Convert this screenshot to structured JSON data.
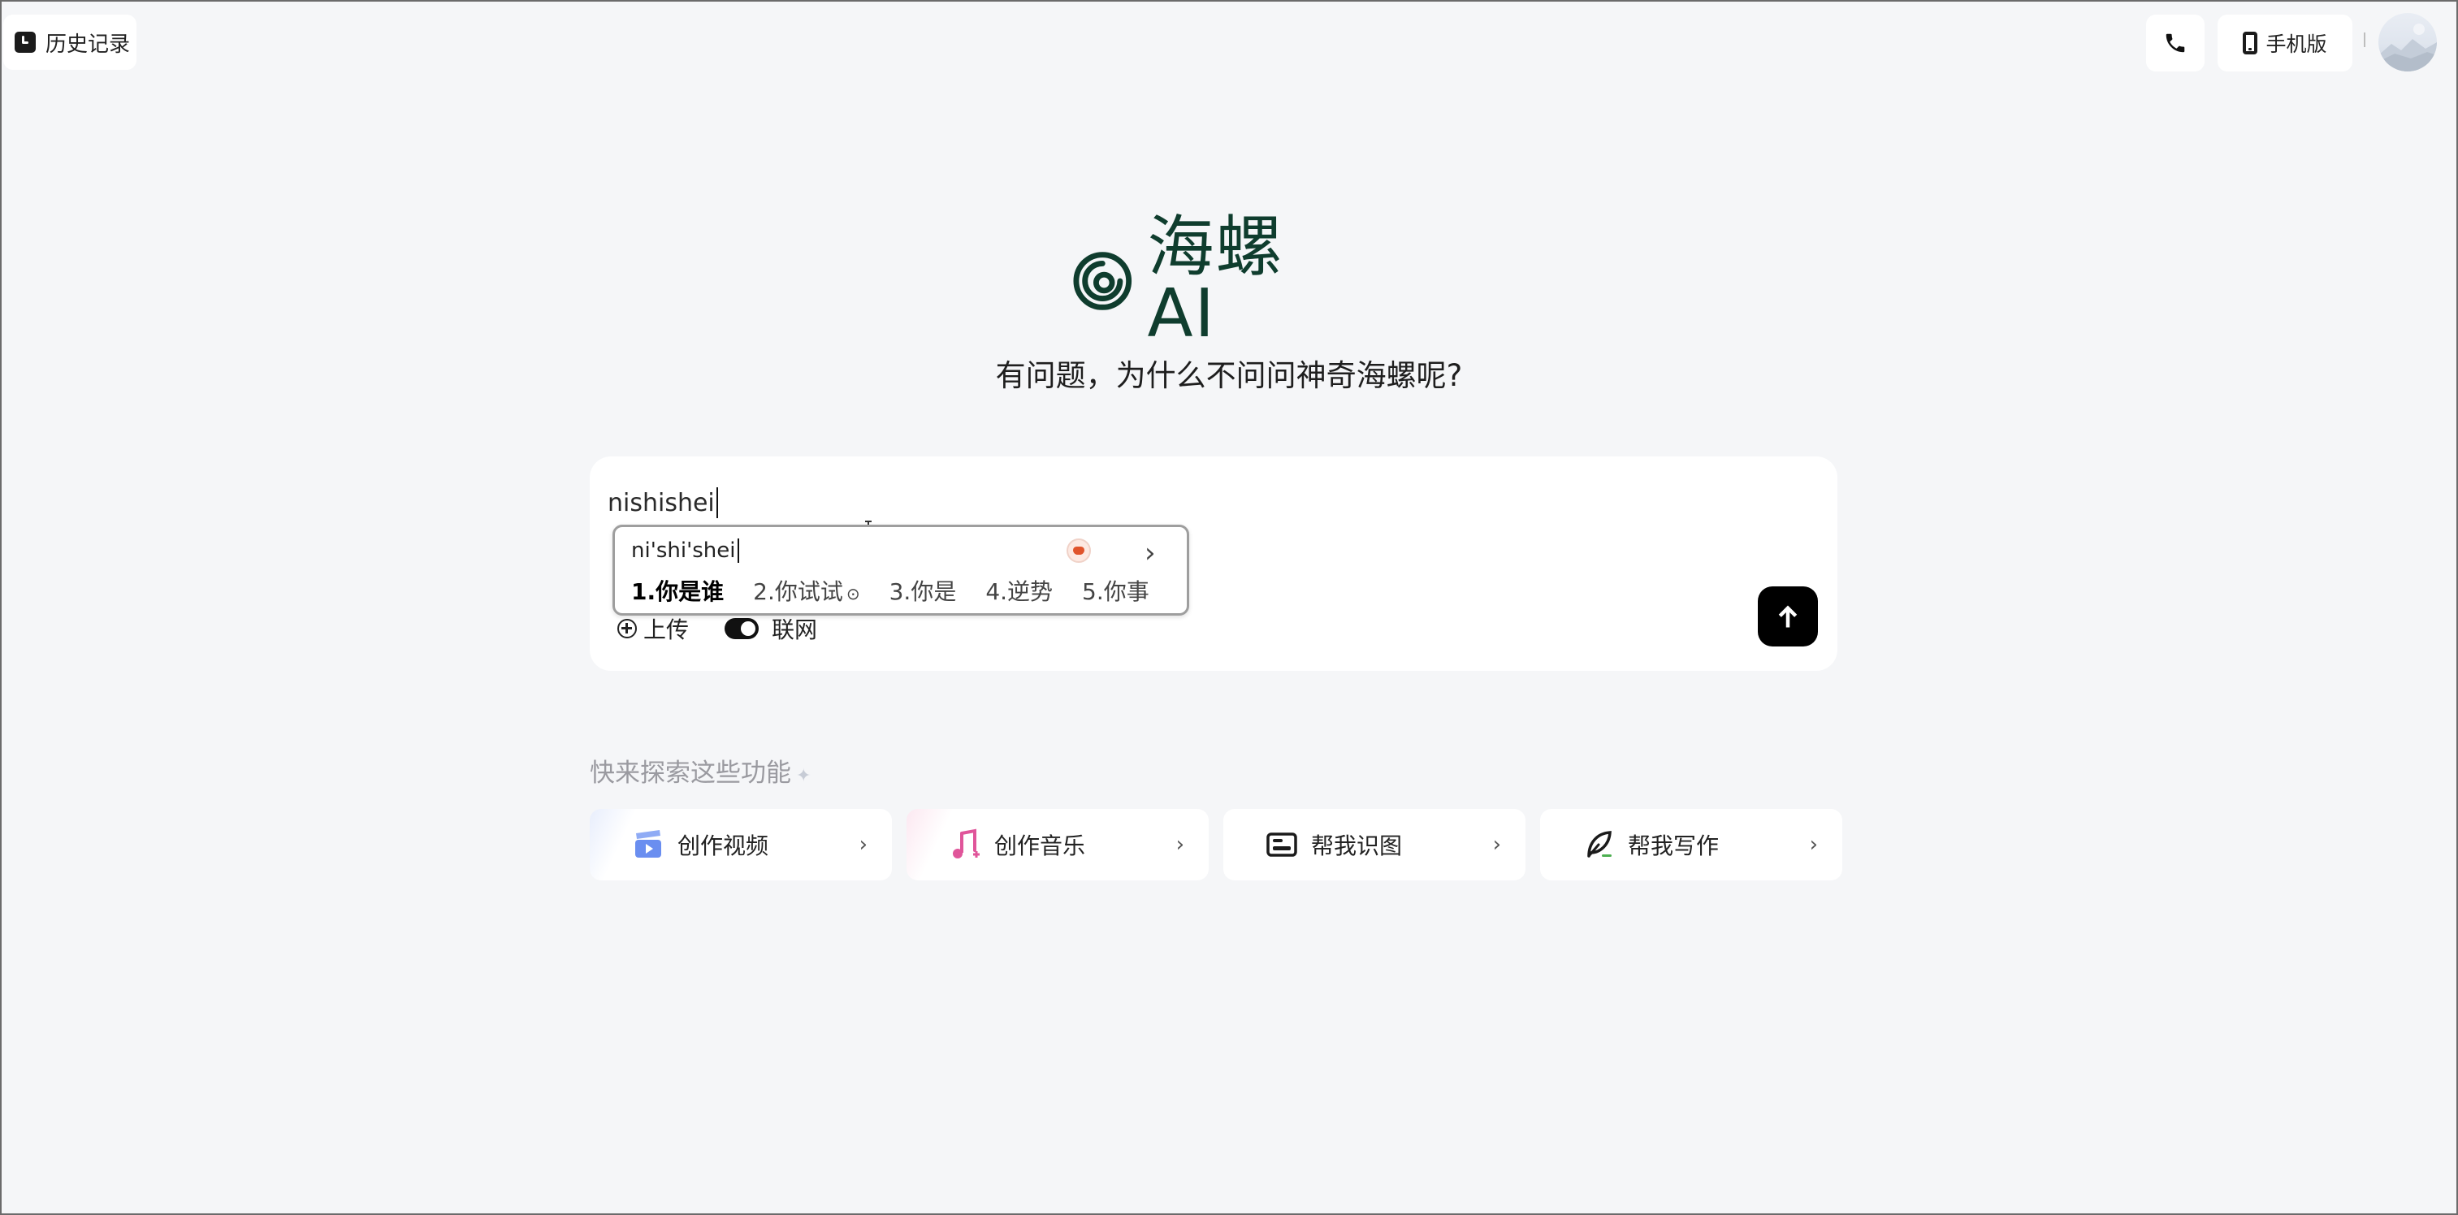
{
  "header": {
    "history_label": "历史记录",
    "mobile_label": "手机版",
    "icons": [
      "clock-icon",
      "phone-icon",
      "tablet-icon",
      "avatar"
    ]
  },
  "brand": {
    "logo_text": "海螺AI",
    "tagline": "有问题，为什么不问问神奇海螺呢?",
    "color": "#0f3d2e"
  },
  "chat": {
    "input_value": "nishishei",
    "upload_label": "上传",
    "web_label": "联网",
    "web_enabled": true,
    "send_icon": "arrow-up-icon"
  },
  "ime": {
    "composition": "ni'shi'shei",
    "candidates": [
      "1.你是谁",
      "2.你试试",
      "3.你是",
      "4.逆势",
      "5.你事"
    ],
    "next_icon": "chevron-right-icon"
  },
  "explore": {
    "title": "快来探索这些功能",
    "cards": [
      {
        "label": "创作视频",
        "icon": "video-clapper-icon",
        "accent": "#6a8ef0"
      },
      {
        "label": "创作音乐",
        "icon": "music-note-icon",
        "accent": "#e0559a"
      },
      {
        "label": "帮我识图",
        "icon": "image-scan-icon",
        "accent": "#1b1b1b"
      },
      {
        "label": "帮我写作",
        "icon": "quill-icon",
        "accent": "#1b1b1b"
      }
    ]
  }
}
